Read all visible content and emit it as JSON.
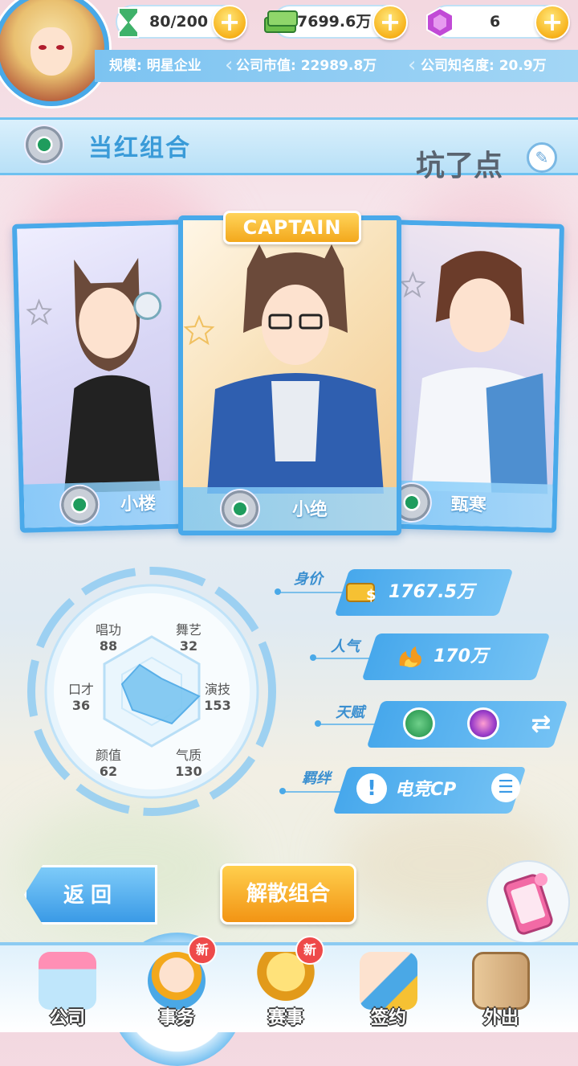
{
  "resources": {
    "stamina": {
      "value": "80/200",
      "icon": "hourglass-icon"
    },
    "money": {
      "value": "7699.6万",
      "icon": "cash-stack-icon"
    },
    "gems": {
      "value": "6",
      "icon": "gem-icon"
    }
  },
  "company": {
    "scale": "规模: 明星企业",
    "market_value": "公司市值: 22989.8万",
    "fame": "公司知名度: 20.9万"
  },
  "group": {
    "title": "当红组合",
    "name": "坑了点"
  },
  "members": [
    {
      "name": "小楼",
      "role": ""
    },
    {
      "name": "小绝",
      "role": "CAPTAIN"
    },
    {
      "name": "甄寒",
      "role": ""
    }
  ],
  "radar": {
    "stats": [
      {
        "label": "唱功",
        "value": "88"
      },
      {
        "label": "舞艺",
        "value": "32"
      },
      {
        "label": "演技",
        "value": "153"
      },
      {
        "label": "气质",
        "value": "130"
      },
      {
        "label": "颜值",
        "value": "62"
      },
      {
        "label": "口才",
        "value": "36"
      }
    ]
  },
  "info": {
    "worth_label": "身价",
    "worth_value": "1767.5万",
    "popularity_label": "人气",
    "popularity_value": "170万",
    "talent_label": "天赋",
    "bond_label": "羁绊",
    "bond_value": "电竞CP"
  },
  "buttons": {
    "back": "返回",
    "disband": "解散组合"
  },
  "nav": [
    {
      "label": "公司",
      "badge": ""
    },
    {
      "label": "事务",
      "badge": "新"
    },
    {
      "label": "赛事",
      "badge": "新"
    },
    {
      "label": "签约",
      "badge": ""
    },
    {
      "label": "外出",
      "badge": ""
    }
  ],
  "colors": {
    "accent": "#49a9ea",
    "gold": "#f3a81c",
    "badge_red": "#ee4a4a"
  }
}
